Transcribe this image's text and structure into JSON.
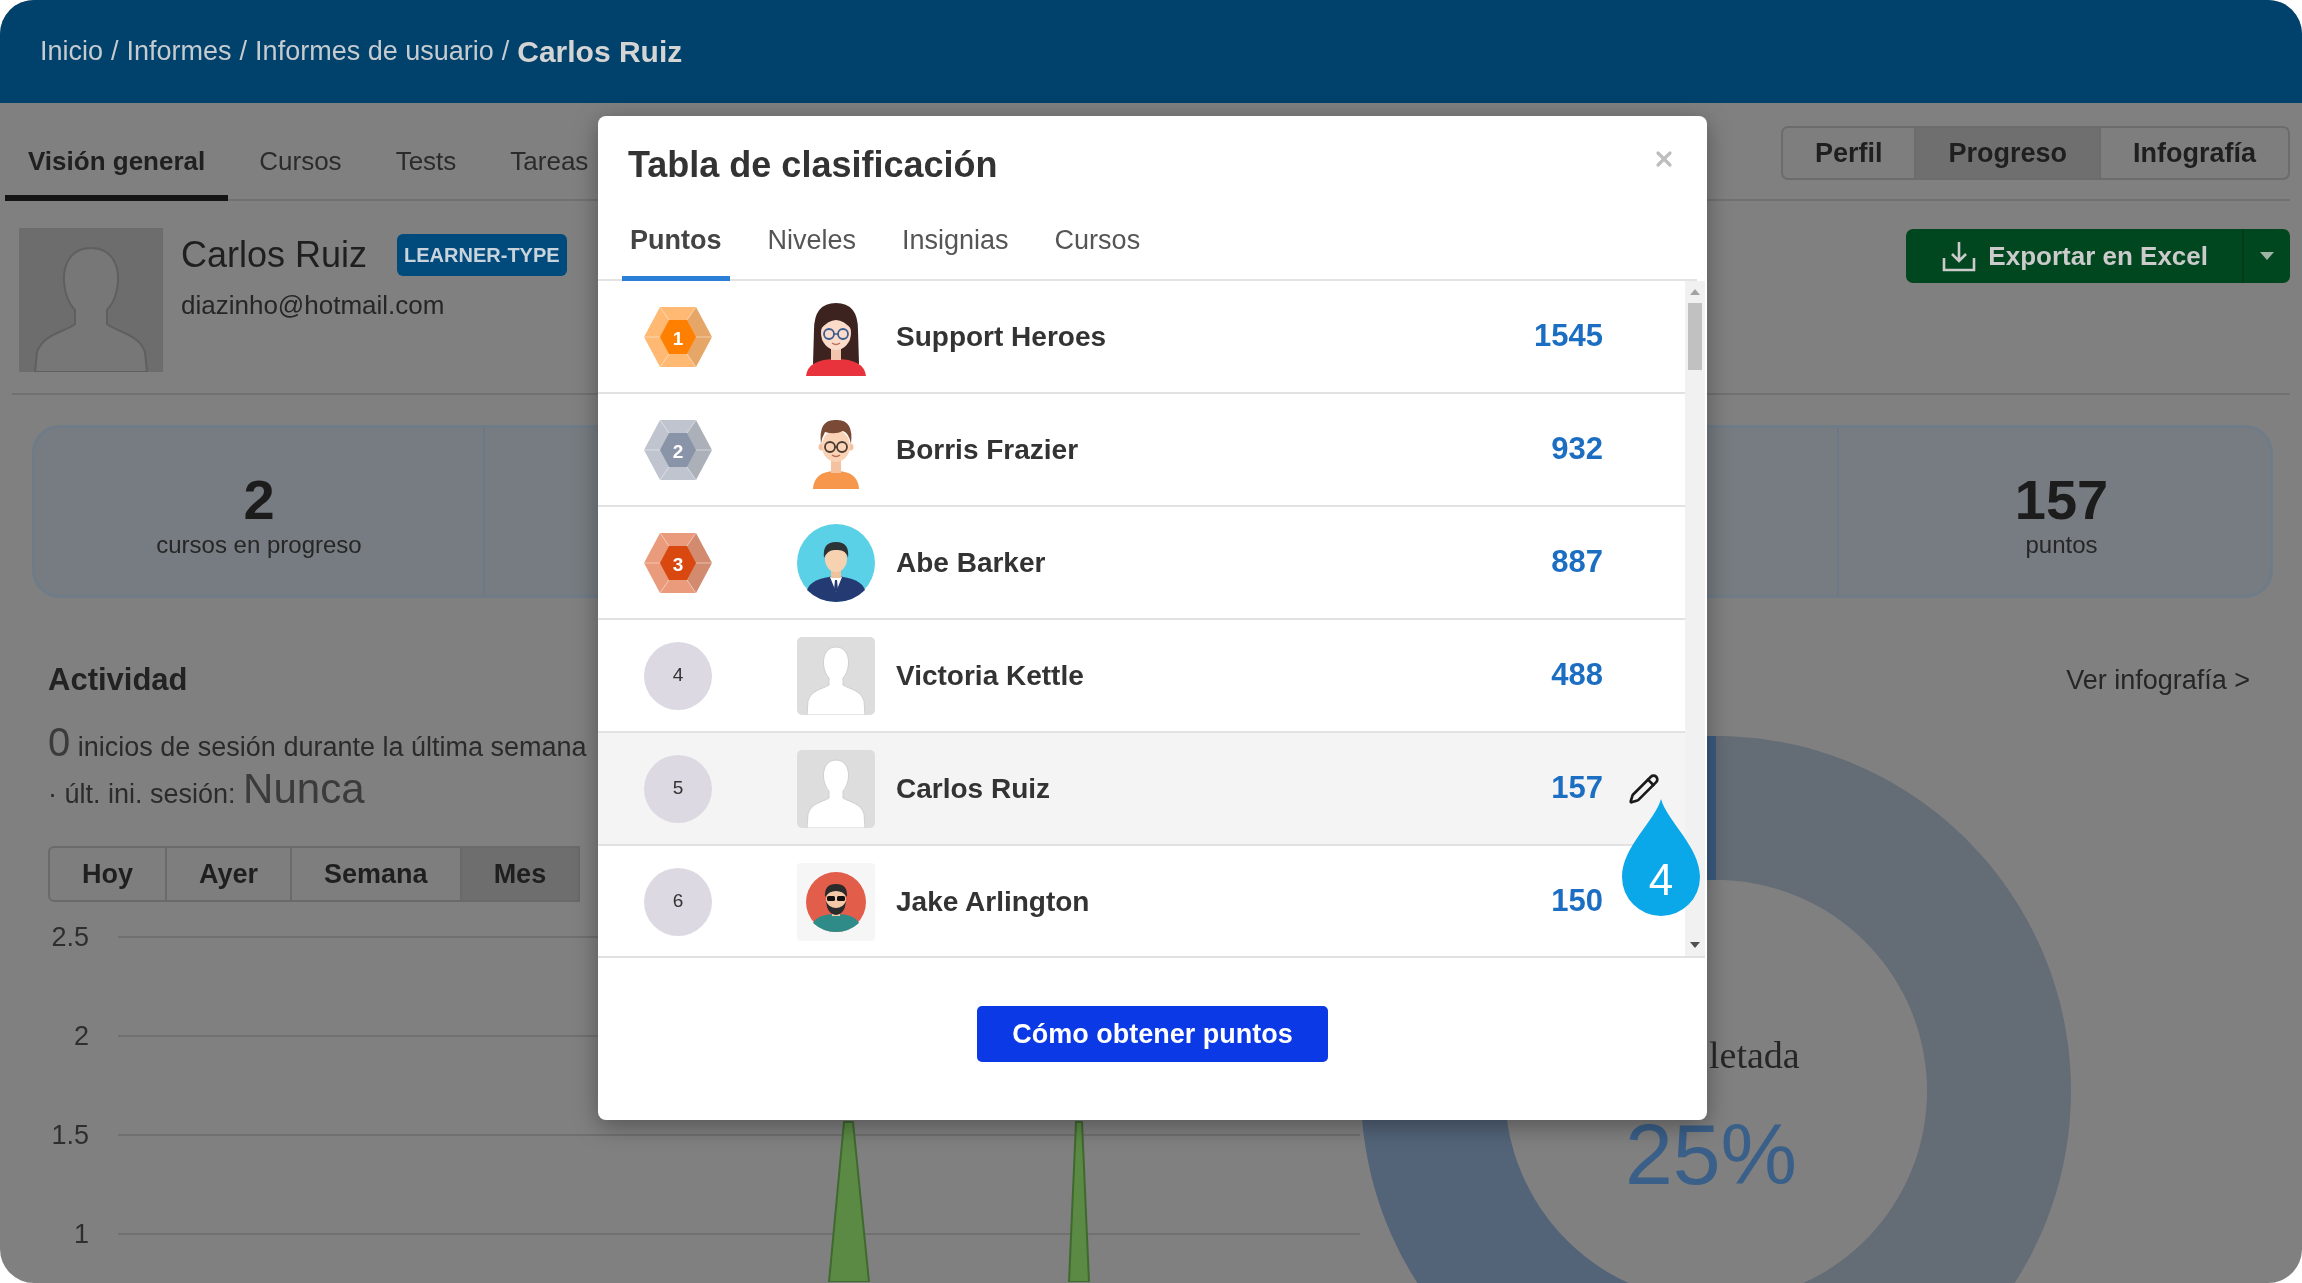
{
  "breadcrumb": [
    {
      "text": "Inicio",
      "kind": "link"
    },
    {
      "text": "/",
      "kind": "separator"
    },
    {
      "text": "Informes",
      "kind": "link"
    },
    {
      "text": "/",
      "kind": "separator"
    },
    {
      "text": "Informes de usuario",
      "kind": "link"
    },
    {
      "text": "/",
      "kind": "separator"
    },
    {
      "text": "Carlos Ruiz",
      "kind": "current"
    }
  ],
  "nav_tabs": [
    {
      "label": "Visión general",
      "selected": true
    },
    {
      "label": "Cursos",
      "selected": false
    },
    {
      "label": "Tests",
      "selected": false
    },
    {
      "label": "Tareas",
      "selected": false
    }
  ],
  "view_buttons": [
    {
      "label": "Perfil",
      "selected": false
    },
    {
      "label": "Progreso",
      "selected": true
    },
    {
      "label": "Infografía",
      "selected": false
    }
  ],
  "profile": {
    "name": "Carlos Ruiz",
    "badge": "LEARNER-TYPE",
    "email": "diazinho@hotmail.com"
  },
  "export_button": {
    "label": "Exportar en Excel"
  },
  "stats": [
    {
      "value": "2",
      "label": "cursos en progreso"
    },
    {
      "value": "157",
      "label": "puntos"
    }
  ],
  "activity": {
    "title": "Actividad",
    "logins_count": "0",
    "logins_text": "inicios de sesión durante la última semana",
    "last_login_label": "· últ. ini. sesión:",
    "last_login_value": "Nunca"
  },
  "time_ranges": [
    {
      "label": "Hoy",
      "selected": false
    },
    {
      "label": "Ayer",
      "selected": false
    },
    {
      "label": "Semana",
      "selected": false
    },
    {
      "label": "Mes",
      "selected": true
    }
  ],
  "activity_chart": {
    "y_labels": [
      "2.5",
      "2",
      "1.5",
      "1"
    ]
  },
  "infographic_link": "Ver infografía >",
  "completion_chart": {
    "label": "letada",
    "value": "25%",
    "level": 0.25
  },
  "leaderboard_dialog": {
    "title": "Tabla de clasificación",
    "tabs": [
      {
        "label": "Puntos",
        "selected": true
      },
      {
        "label": "Niveles",
        "selected": false
      },
      {
        "label": "Insignias",
        "selected": false
      },
      {
        "label": "Cursos",
        "selected": false
      }
    ],
    "rows": [
      {
        "rank": {
          "label": "1",
          "kind": "gem",
          "color": "#ff7f00"
        },
        "avatar": {
          "kind": "illustration"
        },
        "name": "Support Heroes",
        "points": "1545",
        "current": false
      },
      {
        "rank": {
          "label": "2",
          "kind": "gem",
          "color": "#8a94a8"
        },
        "avatar": {
          "kind": "illustration"
        },
        "name": "Borris Frazier",
        "points": "932",
        "current": false
      },
      {
        "rank": {
          "label": "3",
          "kind": "gem",
          "color": "#d9480f"
        },
        "avatar": {
          "kind": "illustration"
        },
        "name": "Abe Barker",
        "points": "887",
        "current": false
      },
      {
        "rank": {
          "label": "4",
          "kind": "circle",
          "color": "#dcd9e2"
        },
        "avatar": {
          "kind": "placeholder"
        },
        "name": "Victoria Kettle",
        "points": "488",
        "current": false
      },
      {
        "rank": {
          "label": "5",
          "kind": "circle",
          "color": "#dcd9e2"
        },
        "avatar": {
          "kind": "placeholder"
        },
        "name": "Carlos Ruiz",
        "points": "157",
        "current": true
      },
      {
        "rank": {
          "label": "6",
          "kind": "circle",
          "color": "#dcd9e2"
        },
        "avatar": {
          "kind": "illustration"
        },
        "name": "Jake Arlington",
        "points": "150",
        "current": false
      }
    ],
    "button": "Cómo obtener puntos",
    "callout": "4"
  }
}
